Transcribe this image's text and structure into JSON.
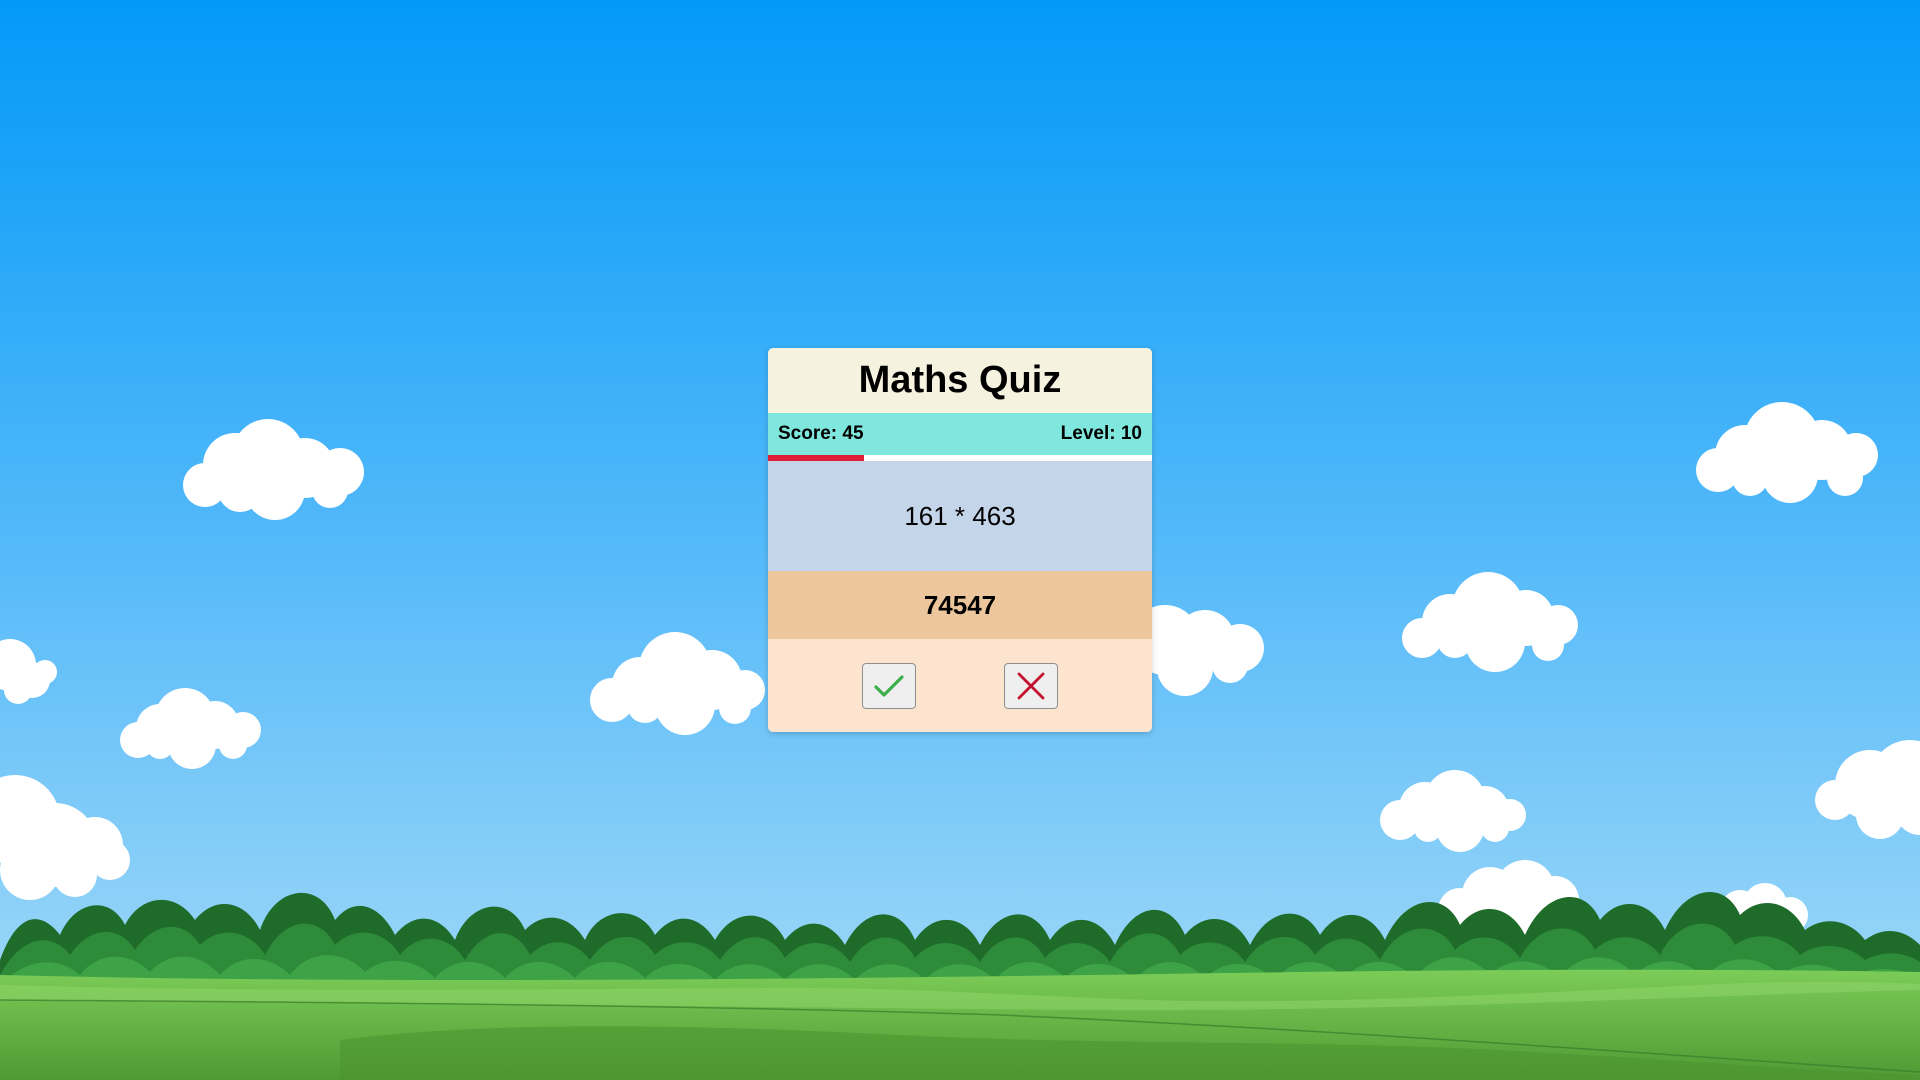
{
  "quiz": {
    "title": "Maths Quiz",
    "score_text": "Score: 45",
    "level_text": "Level: 10",
    "timer_fraction": 0.25,
    "question": "161 * 463",
    "proposed_answer": "74547",
    "correct_icon": "checkmark-icon",
    "wrong_icon": "cross-icon"
  },
  "colors": {
    "sky_top": "#0399f8",
    "sky_bottom": "#a9dcf8",
    "header_bg": "#f5f3df",
    "status_bg": "#80e7df",
    "timer_fill": "#e01e35",
    "question_bg": "#c4d5ea",
    "answer_bg": "#ecc79d",
    "buttons_bg": "#fde4cf",
    "check_color": "#3cae4c",
    "cross_color": "#c2102e",
    "grass": "#5ba63c",
    "trees": "#2e8b3a"
  }
}
